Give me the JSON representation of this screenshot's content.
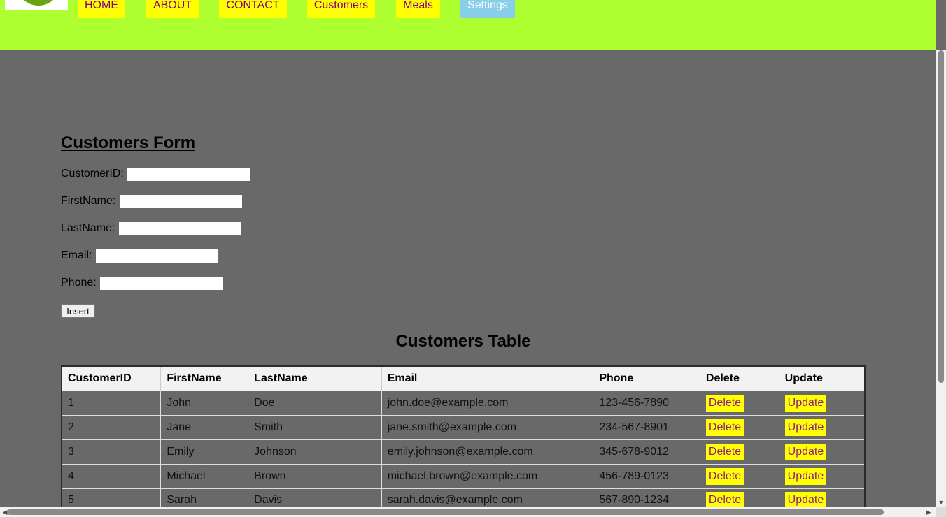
{
  "nav": {
    "items": [
      {
        "label": "HOME"
      },
      {
        "label": "ABOUT"
      },
      {
        "label": "CONTACT"
      },
      {
        "label": "Customers"
      },
      {
        "label": "Meals"
      },
      {
        "label": "Settings"
      }
    ]
  },
  "form": {
    "title": "Customers Form",
    "fields": [
      {
        "label": "CustomerID:",
        "value": ""
      },
      {
        "label": "FirstName:",
        "value": ""
      },
      {
        "label": "LastName:",
        "value": ""
      },
      {
        "label": "Email:",
        "value": ""
      },
      {
        "label": "Phone:",
        "value": ""
      }
    ],
    "insert_label": "Insert"
  },
  "table": {
    "title": "Customers Table",
    "headers": [
      "CustomerID",
      "FirstName",
      "LastName",
      "Email",
      "Phone",
      "Delete",
      "Update"
    ],
    "rows": [
      {
        "id": "1",
        "first": "John",
        "last": "Doe",
        "email": "john.doe@example.com",
        "phone": "123-456-7890",
        "delete": "Delete",
        "update": "Update"
      },
      {
        "id": "2",
        "first": "Jane",
        "last": "Smith",
        "email": "jane.smith@example.com",
        "phone": "234-567-8901",
        "delete": "Delete",
        "update": "Update"
      },
      {
        "id": "3",
        "first": "Emily",
        "last": "Johnson",
        "email": "emily.johnson@example.com",
        "phone": "345-678-9012",
        "delete": "Delete",
        "update": "Update"
      },
      {
        "id": "4",
        "first": "Michael",
        "last": "Brown",
        "email": "michael.brown@example.com",
        "phone": "456-789-0123",
        "delete": "Delete",
        "update": "Update"
      },
      {
        "id": "5",
        "first": "Sarah",
        "last": "Davis",
        "email": "sarah.davis@example.com",
        "phone": "567-890-1234",
        "delete": "Delete",
        "update": "Update"
      }
    ]
  },
  "colors": {
    "header_bg": "#adff2f",
    "page_bg": "#696969",
    "nav_bg": "#ffff00",
    "nav_text": "#800080",
    "nav_active_bg": "#87ceeb"
  },
  "icons": {
    "logo": "logo-icon",
    "scroll_up": "arrow-up-icon",
    "scroll_down": "arrow-down-icon",
    "scroll_left": "arrow-left-icon",
    "scroll_right": "arrow-right-icon"
  }
}
